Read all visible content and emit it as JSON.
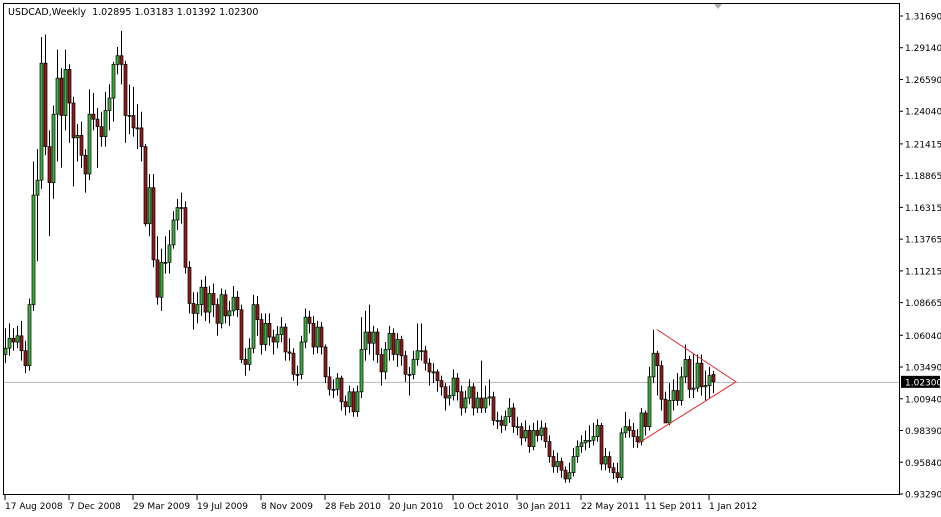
{
  "header": {
    "symbol": "USDCAD,Weekly",
    "open": "1.02895",
    "high": "1.03183",
    "low": "1.01392",
    "close": "1.02300"
  },
  "colors": {
    "bull": "#3fae3f",
    "bear": "#8e1c1c",
    "outline": "#000000",
    "triangle": "#e0303a",
    "price_line": "#b4b4b4",
    "price_tag_bg": "#000000"
  },
  "chart_data": {
    "type": "candlestick",
    "title": "USDCAD,Weekly",
    "ylim": [
      0.9329,
      1.3169
    ],
    "yticks": [
      "1.31690",
      "1.29140",
      "1.26590",
      "1.24040",
      "1.21415",
      "1.18865",
      "1.16315",
      "1.13765",
      "1.11215",
      "1.08665",
      "1.06040",
      "1.03490",
      "1.00940",
      "0.98390",
      "0.95840",
      "0.93290"
    ],
    "current_price": "1.02300",
    "xticks": [
      {
        "index": 0,
        "label": "17 Aug 2008"
      },
      {
        "index": 16,
        "label": "7 Dec 2008"
      },
      {
        "index": 32,
        "label": "29 Mar 2009"
      },
      {
        "index": 48,
        "label": "19 Jul 2009"
      },
      {
        "index": 64,
        "label": "8 Nov 2009"
      },
      {
        "index": 80,
        "label": "28 Feb 2010"
      },
      {
        "index": 96,
        "label": "20 Jun 2010"
      },
      {
        "index": 112,
        "label": "10 Oct 2010"
      },
      {
        "index": 128,
        "label": "30 Jan 2011"
      },
      {
        "index": 144,
        "label": "22 May 2011"
      },
      {
        "index": 160,
        "label": "11 Sep 2011"
      },
      {
        "index": 176,
        "label": "1 Jan 2012"
      }
    ],
    "triangle": {
      "top": [
        163,
        1.065
      ],
      "bottom": [
        158,
        0.973
      ],
      "apex": [
        182.75,
        1.023
      ]
    },
    "ohlc": [
      [
        1.045,
        1.066,
        1.038,
        1.05
      ],
      [
        1.05,
        1.07,
        1.044,
        1.058
      ],
      [
        1.058,
        1.066,
        1.048,
        1.055
      ],
      [
        1.055,
        1.068,
        1.05,
        1.06
      ],
      [
        1.06,
        1.072,
        1.04,
        1.048
      ],
      [
        1.048,
        1.056,
        1.03,
        1.036
      ],
      [
        1.036,
        1.09,
        1.032,
        1.085
      ],
      [
        1.085,
        1.2,
        1.08,
        1.173
      ],
      [
        1.173,
        1.21,
        1.12,
        1.185
      ],
      [
        1.185,
        1.3,
        1.178,
        1.279
      ],
      [
        1.279,
        1.302,
        1.205,
        1.212
      ],
      [
        1.212,
        1.225,
        1.14,
        1.183
      ],
      [
        1.183,
        1.245,
        1.17,
        1.238
      ],
      [
        1.238,
        1.29,
        1.2,
        1.267
      ],
      [
        1.267,
        1.275,
        1.195,
        1.237
      ],
      [
        1.237,
        1.29,
        1.225,
        1.274
      ],
      [
        1.274,
        1.278,
        1.215,
        1.247
      ],
      [
        1.247,
        1.252,
        1.18,
        1.219
      ],
      [
        1.219,
        1.23,
        1.2,
        1.221
      ],
      [
        1.221,
        1.232,
        1.195,
        1.205
      ],
      [
        1.205,
        1.21,
        1.175,
        1.19
      ],
      [
        1.19,
        1.258,
        1.185,
        1.238
      ],
      [
        1.238,
        1.255,
        1.225,
        1.234
      ],
      [
        1.234,
        1.243,
        1.195,
        1.228
      ],
      [
        1.228,
        1.24,
        1.212,
        1.22
      ],
      [
        1.22,
        1.256,
        1.212,
        1.241
      ],
      [
        1.241,
        1.262,
        1.225,
        1.251
      ],
      [
        1.251,
        1.28,
        1.232,
        1.278
      ],
      [
        1.278,
        1.292,
        1.27,
        1.285
      ],
      [
        1.285,
        1.305,
        1.262,
        1.278
      ],
      [
        1.278,
        1.281,
        1.215,
        1.237
      ],
      [
        1.237,
        1.262,
        1.222,
        1.237
      ],
      [
        1.237,
        1.26,
        1.22,
        1.227
      ],
      [
        1.227,
        1.246,
        1.21,
        1.227
      ],
      [
        1.227,
        1.24,
        1.2,
        1.212
      ],
      [
        1.212,
        1.214,
        1.148,
        1.15
      ],
      [
        1.15,
        1.19,
        1.14,
        1.179
      ],
      [
        1.179,
        1.19,
        1.115,
        1.121
      ],
      [
        1.121,
        1.14,
        1.085,
        1.091
      ],
      [
        1.091,
        1.13,
        1.08,
        1.119
      ],
      [
        1.119,
        1.14,
        1.11,
        1.119
      ],
      [
        1.119,
        1.145,
        1.11,
        1.133
      ],
      [
        1.133,
        1.16,
        1.13,
        1.153
      ],
      [
        1.153,
        1.17,
        1.145,
        1.163
      ],
      [
        1.163,
        1.175,
        1.15,
        1.163
      ],
      [
        1.163,
        1.168,
        1.11,
        1.115
      ],
      [
        1.115,
        1.12,
        1.078,
        1.086
      ],
      [
        1.086,
        1.095,
        1.065,
        1.078
      ],
      [
        1.078,
        1.095,
        1.07,
        1.085
      ],
      [
        1.085,
        1.105,
        1.076,
        1.099
      ],
      [
        1.099,
        1.108,
        1.072,
        1.079
      ],
      [
        1.079,
        1.1,
        1.07,
        1.094
      ],
      [
        1.094,
        1.102,
        1.075,
        1.085
      ],
      [
        1.085,
        1.09,
        1.06,
        1.07
      ],
      [
        1.07,
        1.098,
        1.066,
        1.093
      ],
      [
        1.093,
        1.097,
        1.07,
        1.076
      ],
      [
        1.076,
        1.088,
        1.068,
        1.08
      ],
      [
        1.08,
        1.1,
        1.076,
        1.091
      ],
      [
        1.091,
        1.096,
        1.075,
        1.081
      ],
      [
        1.081,
        1.085,
        1.038,
        1.041
      ],
      [
        1.041,
        1.05,
        1.028,
        1.037
      ],
      [
        1.037,
        1.058,
        1.032,
        1.05
      ],
      [
        1.05,
        1.093,
        1.046,
        1.085
      ],
      [
        1.085,
        1.092,
        1.06,
        1.073
      ],
      [
        1.073,
        1.078,
        1.045,
        1.053
      ],
      [
        1.053,
        1.078,
        1.048,
        1.07
      ],
      [
        1.07,
        1.078,
        1.052,
        1.059
      ],
      [
        1.059,
        1.065,
        1.045,
        1.055
      ],
      [
        1.055,
        1.068,
        1.05,
        1.061
      ],
      [
        1.061,
        1.075,
        1.055,
        1.067
      ],
      [
        1.067,
        1.07,
        1.04,
        1.047
      ],
      [
        1.047,
        1.058,
        1.04,
        1.046
      ],
      [
        1.046,
        1.05,
        1.024,
        1.029
      ],
      [
        1.029,
        1.036,
        1.02,
        1.029
      ],
      [
        1.029,
        1.06,
        1.025,
        1.055
      ],
      [
        1.055,
        1.082,
        1.05,
        1.075
      ],
      [
        1.075,
        1.08,
        1.062,
        1.07
      ],
      [
        1.07,
        1.076,
        1.045,
        1.051
      ],
      [
        1.051,
        1.072,
        1.046,
        1.067
      ],
      [
        1.067,
        1.071,
        1.045,
        1.051
      ],
      [
        1.051,
        1.053,
        1.022,
        1.027
      ],
      [
        1.027,
        1.035,
        1.012,
        1.017
      ],
      [
        1.017,
        1.025,
        1.01,
        1.017
      ],
      [
        1.017,
        1.03,
        1.012,
        1.026
      ],
      [
        1.026,
        1.028,
        1.0,
        1.007
      ],
      [
        1.007,
        1.012,
        0.996,
        1.003
      ],
      [
        1.003,
        1.02,
        0.998,
        1.015
      ],
      [
        1.015,
        1.018,
        0.995,
        0.999
      ],
      [
        0.999,
        1.02,
        0.995,
        1.015
      ],
      [
        1.015,
        1.075,
        1.01,
        1.049
      ],
      [
        1.049,
        1.08,
        1.04,
        1.063
      ],
      [
        1.063,
        1.085,
        1.045,
        1.054
      ],
      [
        1.054,
        1.068,
        1.04,
        1.063
      ],
      [
        1.063,
        1.066,
        1.038,
        1.045
      ],
      [
        1.045,
        1.05,
        1.02,
        1.031
      ],
      [
        1.031,
        1.055,
        1.025,
        1.049
      ],
      [
        1.049,
        1.068,
        1.04,
        1.062
      ],
      [
        1.062,
        1.066,
        1.04,
        1.045
      ],
      [
        1.045,
        1.062,
        1.035,
        1.057
      ],
      [
        1.057,
        1.06,
        1.036,
        1.044
      ],
      [
        1.044,
        1.048,
        1.023,
        1.029
      ],
      [
        1.029,
        1.035,
        1.012,
        1.029
      ],
      [
        1.029,
        1.048,
        1.025,
        1.041
      ],
      [
        1.041,
        1.07,
        1.036,
        1.048
      ],
      [
        1.048,
        1.07,
        1.04,
        1.048
      ],
      [
        1.048,
        1.052,
        1.032,
        1.038
      ],
      [
        1.038,
        1.042,
        1.02,
        1.031
      ],
      [
        1.031,
        1.038,
        1.022,
        1.031
      ],
      [
        1.031,
        1.033,
        1.015,
        1.024
      ],
      [
        1.024,
        1.028,
        1.012,
        1.019
      ],
      [
        1.019,
        1.022,
        1.0,
        1.01
      ],
      [
        1.01,
        1.02,
        1.004,
        1.012
      ],
      [
        1.012,
        1.033,
        1.008,
        1.026
      ],
      [
        1.026,
        1.03,
        1.008,
        1.015
      ],
      [
        1.015,
        1.02,
        0.996,
        1.002
      ],
      [
        1.002,
        1.016,
        0.998,
        1.01
      ],
      [
        1.01,
        1.025,
        1.005,
        1.019
      ],
      [
        1.019,
        1.022,
        0.996,
        1.002
      ],
      [
        1.002,
        1.015,
        0.998,
        1.01
      ],
      [
        1.01,
        1.04,
        0.998,
        1.002
      ],
      [
        1.002,
        1.02,
        0.998,
        1.01
      ],
      [
        1.01,
        1.025,
        1.004,
        1.011
      ],
      [
        1.011,
        1.015,
        0.988,
        0.992
      ],
      [
        0.992,
        0.999,
        0.985,
        0.992
      ],
      [
        0.992,
        0.996,
        0.982,
        0.988
      ],
      [
        0.988,
        1.0,
        0.984,
        0.995
      ],
      [
        0.995,
        1.01,
        0.99,
        1.002
      ],
      [
        1.002,
        1.006,
        0.982,
        0.987
      ],
      [
        0.987,
        0.995,
        0.98,
        0.987
      ],
      [
        0.987,
        0.99,
        0.972,
        0.978
      ],
      [
        0.978,
        0.992,
        0.975,
        0.984
      ],
      [
        0.984,
        0.988,
        0.966,
        0.971
      ],
      [
        0.971,
        0.99,
        0.968,
        0.984
      ],
      [
        0.984,
        0.992,
        0.975,
        0.98
      ],
      [
        0.98,
        0.992,
        0.976,
        0.986
      ],
      [
        0.986,
        0.99,
        0.97,
        0.975
      ],
      [
        0.975,
        0.98,
        0.958,
        0.963
      ],
      [
        0.963,
        0.968,
        0.95,
        0.955
      ],
      [
        0.955,
        0.966,
        0.95,
        0.959
      ],
      [
        0.959,
        0.962,
        0.946,
        0.952
      ],
      [
        0.952,
        0.955,
        0.942,
        0.945
      ],
      [
        0.945,
        0.958,
        0.942,
        0.95
      ],
      [
        0.95,
        0.97,
        0.947,
        0.963
      ],
      [
        0.963,
        0.976,
        0.958,
        0.971
      ],
      [
        0.971,
        0.98,
        0.966,
        0.974
      ],
      [
        0.974,
        0.984,
        0.968,
        0.976
      ],
      [
        0.976,
        0.988,
        0.97,
        0.976
      ],
      [
        0.976,
        0.99,
        0.972,
        0.979
      ],
      [
        0.979,
        0.993,
        0.975,
        0.988
      ],
      [
        0.988,
        0.99,
        0.952,
        0.957
      ],
      [
        0.957,
        0.97,
        0.952,
        0.963
      ],
      [
        0.963,
        0.967,
        0.95,
        0.954
      ],
      [
        0.954,
        0.958,
        0.945,
        0.95
      ],
      [
        0.95,
        0.958,
        0.942,
        0.946
      ],
      [
        0.946,
        0.986,
        0.944,
        0.982
      ],
      [
        0.982,
        0.999,
        0.978,
        0.987
      ],
      [
        0.987,
        0.993,
        0.978,
        0.984
      ],
      [
        0.984,
        0.99,
        0.97,
        0.979
      ],
      [
        0.979,
        0.985,
        0.97,
        0.975
      ],
      [
        0.975,
        1.002,
        0.972,
        0.998
      ],
      [
        0.998,
        1.0,
        0.98,
        0.987
      ],
      [
        0.987,
        1.035,
        0.984,
        1.027
      ],
      [
        1.027,
        1.065,
        1.022,
        1.046
      ],
      [
        1.046,
        1.048,
        1.012,
        1.036
      ],
      [
        1.036,
        1.04,
        1.0,
        1.009
      ],
      [
        1.009,
        1.015,
        0.994,
        0.99
      ],
      [
        0.99,
        1.022,
        0.988,
        1.008
      ],
      [
        1.008,
        1.025,
        1.0,
        1.016
      ],
      [
        1.016,
        1.03,
        1.004,
        1.008
      ],
      [
        1.008,
        1.035,
        1.004,
        1.027
      ],
      [
        1.027,
        1.053,
        1.022,
        1.041
      ],
      [
        1.041,
        1.044,
        1.01,
        1.017
      ],
      [
        1.017,
        1.046,
        1.01,
        1.018
      ],
      [
        1.018,
        1.045,
        1.015,
        1.038
      ],
      [
        1.038,
        1.045,
        1.012,
        1.019
      ],
      [
        1.019,
        1.032,
        1.008,
        1.02
      ],
      [
        1.02,
        1.035,
        1.01,
        1.028
      ],
      [
        1.02895,
        1.03183,
        1.01392,
        1.023
      ]
    ]
  }
}
